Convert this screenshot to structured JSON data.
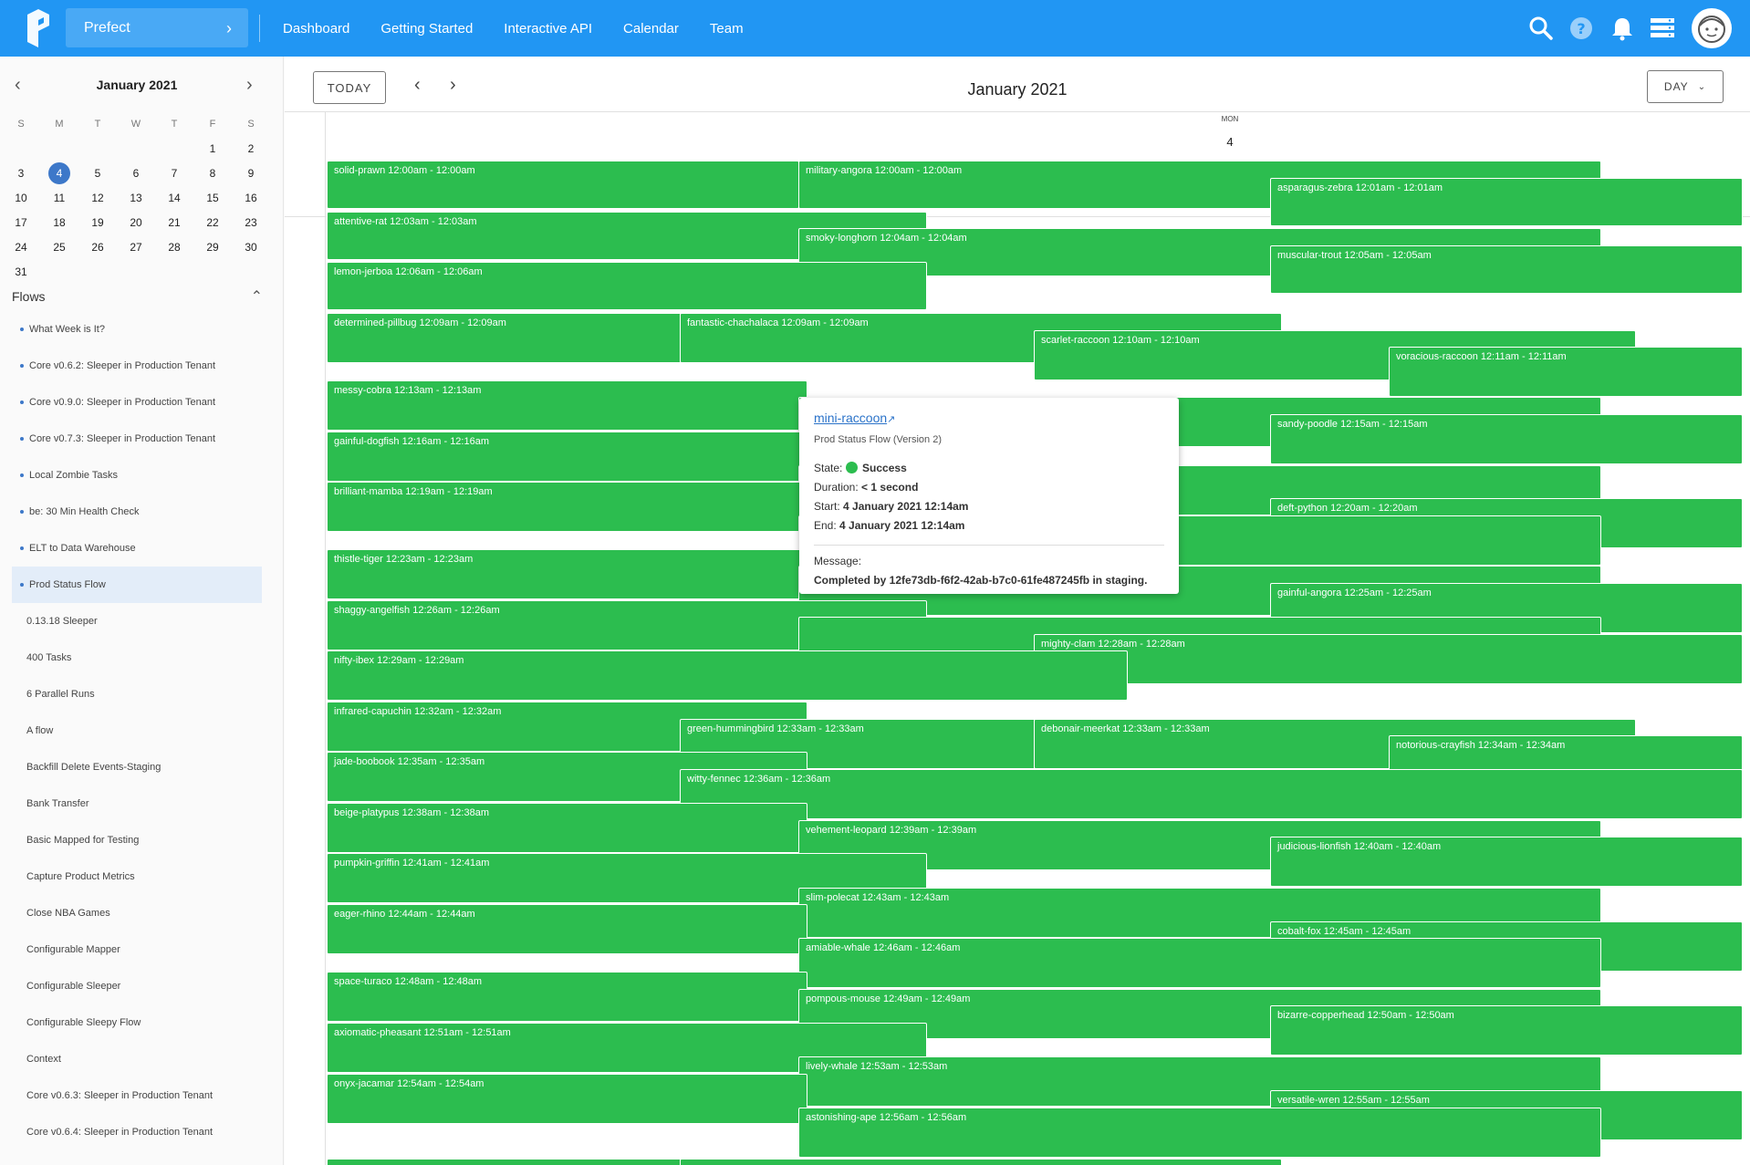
{
  "topbar": {
    "team": "Prefect",
    "nav": [
      "Dashboard",
      "Getting Started",
      "Interactive API",
      "Calendar",
      "Team"
    ],
    "icons": [
      "search-icon",
      "help-icon",
      "bell-icon",
      "server-icon",
      "avatar-icon"
    ],
    "color": "#2196f3"
  },
  "mini_calendar": {
    "title": "January 2021",
    "dow": [
      "S",
      "M",
      "T",
      "W",
      "T",
      "F",
      "S"
    ],
    "weeks": [
      [
        "",
        "",
        "",
        "",
        "",
        "1",
        "2"
      ],
      [
        "3",
        "4",
        "5",
        "6",
        "7",
        "8",
        "9"
      ],
      [
        "10",
        "11",
        "12",
        "13",
        "14",
        "15",
        "16"
      ],
      [
        "17",
        "18",
        "19",
        "20",
        "21",
        "22",
        "23"
      ],
      [
        "24",
        "25",
        "26",
        "27",
        "28",
        "29",
        "30"
      ],
      [
        "31",
        "",
        "",
        "",
        "",
        "",
        ""
      ]
    ],
    "selected": "4"
  },
  "flows": {
    "label": "Flows",
    "items": [
      {
        "label": "What Week is It?",
        "dot": true
      },
      {
        "label": "Core v0.6.2: Sleeper in Production Tenant",
        "dot": true
      },
      {
        "label": "Core v0.9.0: Sleeper in Production Tenant",
        "dot": true
      },
      {
        "label": "Core v0.7.3: Sleeper in Production Tenant",
        "dot": true
      },
      {
        "label": "Local Zombie Tasks",
        "dot": true
      },
      {
        "label": "be: 30 Min Health Check",
        "dot": true
      },
      {
        "label": "ELT to Data Warehouse",
        "dot": true
      },
      {
        "label": "Prod Status Flow",
        "dot": true,
        "active": true
      },
      {
        "label": "0.13.18 Sleeper",
        "dot": false
      },
      {
        "label": "400 Tasks",
        "dot": false
      },
      {
        "label": "6 Parallel Runs",
        "dot": false
      },
      {
        "label": "A flow",
        "dot": false
      },
      {
        "label": "Backfill Delete Events-Staging",
        "dot": false
      },
      {
        "label": "Bank Transfer",
        "dot": false
      },
      {
        "label": "Basic Mapped for Testing",
        "dot": false
      },
      {
        "label": "Capture Product Metrics",
        "dot": false
      },
      {
        "label": "Close NBA Games",
        "dot": false
      },
      {
        "label": "Configurable Mapper",
        "dot": false
      },
      {
        "label": "Configurable Sleeper",
        "dot": false
      },
      {
        "label": "Configurable Sleepy Flow",
        "dot": false
      },
      {
        "label": "Context",
        "dot": false
      },
      {
        "label": "Core v0.6.3: Sleeper in Production Tenant",
        "dot": false
      },
      {
        "label": "Core v0.6.4: Sleeper in Production Tenant",
        "dot": false
      }
    ]
  },
  "calendar": {
    "today_label": "TODAY",
    "title": "January 2021",
    "view_label": "DAY",
    "day_of_week": "MON",
    "day_num": "4",
    "event_color": "#2cbd4f",
    "events": [
      "solid-prawn 12:00am - 12:00am",
      "military-angora 12:00am - 12:00am",
      "asparagus-zebra 12:01am - 12:01am",
      "attentive-rat 12:03am - 12:03am",
      "smoky-longhorn 12:04am - 12:04am",
      "muscular-trout 12:05am - 12:05am",
      "lemon-jerboa 12:06am - 12:06am",
      "determined-pillbug 12:09am - 12:09am",
      "fantastic-chachalaca 12:09am - 12:09am",
      "scarlet-raccoon 12:10am - 12:10am",
      "voracious-raccoon 12:11am - 12:11am",
      "messy-cobra 12:13am - 12:13am",
      "",
      "sandy-poodle 12:15am - 12:15am",
      "gainful-dogfish 12:16am - 12:16am",
      "",
      "brilliant-mamba 12:19am - 12:19am",
      "deft-python 12:20am - 12:20am",
      "",
      "thistle-tiger 12:23am - 12:23am",
      "",
      "gainful-angora 12:25am - 12:25am",
      "shaggy-angelfish 12:26am - 12:26am",
      "",
      "mighty-clam 12:28am - 12:28am",
      "nifty-ibex 12:29am - 12:29am",
      "infrared-capuchin 12:32am - 12:32am",
      "green-hummingbird 12:33am - 12:33am",
      "debonair-meerkat 12:33am - 12:33am",
      "notorious-crayfish 12:34am - 12:34am",
      "jade-boobook 12:35am - 12:35am",
      "witty-fennec 12:36am - 12:36am",
      "beige-platypus 12:38am - 12:38am",
      "vehement-leopard 12:39am - 12:39am",
      "judicious-lionfish 12:40am - 12:40am",
      "pumpkin-griffin 12:41am - 12:41am",
      "slim-polecat 12:43am - 12:43am",
      "eager-rhino 12:44am - 12:44am",
      "cobalt-fox 12:45am - 12:45am",
      "amiable-whale 12:46am - 12:46am",
      "space-turaco 12:48am - 12:48am",
      "pompous-mouse 12:49am - 12:49am",
      "bizarre-copperhead 12:50am - 12:50am",
      "axiomatic-pheasant 12:51am - 12:51am",
      "lively-whale 12:53am - 12:53am",
      "onyx-jacamar 12:54am - 12:54am",
      "versatile-wren 12:55am - 12:55am",
      "astonishing-ape 12:56am - 12:56am",
      "",
      ""
    ]
  },
  "popup": {
    "run_name": "mini-raccoon",
    "flow": "Prod Status Flow (Version 2)",
    "state_label": "State:",
    "state_value": "Success",
    "duration_label": "Duration:",
    "duration_value": "< 1 second",
    "start_label": "Start:",
    "start_value": "4 January 2021 12:14am",
    "end_label": "End:",
    "end_value": "4 January 2021 12:14am",
    "message_label": "Message:",
    "message_value": "Completed by 12fe73db-f6f2-42ab-b7c0-61fe487245fb in staging."
  }
}
